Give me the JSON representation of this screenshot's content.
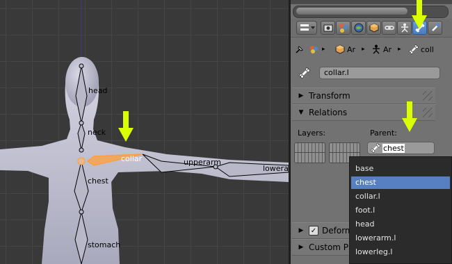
{
  "viewport": {
    "bones": [
      "head",
      "neck",
      "collar",
      "upperarm",
      "lowerarm",
      "chest",
      "stomach"
    ],
    "selected_bone": "collar"
  },
  "properties": {
    "tabs": [
      "render-icon",
      "scene-icon",
      "world-icon",
      "object-icon",
      "constraint-icon",
      "armature-icon",
      "bone-icon",
      "bone-constraint-icon"
    ],
    "active_tab": "bone-icon",
    "breadcrumb": [
      "Ar",
      "Ar",
      "coll"
    ],
    "bone_name": "collar.l",
    "sections": {
      "transform": "Transform",
      "relations": "Relations",
      "deform": "Deform",
      "custom": "Custom Pro"
    },
    "layers_label": "Layers:",
    "parent_label": "Parent:",
    "parent_value": "chest"
  },
  "dropdown": {
    "items": [
      "base",
      "chest",
      "collar.l",
      "foot.l",
      "head",
      "lowerarm.l",
      "lowerleg.l"
    ],
    "selected": "chest"
  },
  "colors": {
    "panel_bg": "#727272",
    "viewport_bg": "#393939",
    "highlight": "#5680c2",
    "arrow": "#d9ff00",
    "selected_bone": "#ff9d3a"
  }
}
